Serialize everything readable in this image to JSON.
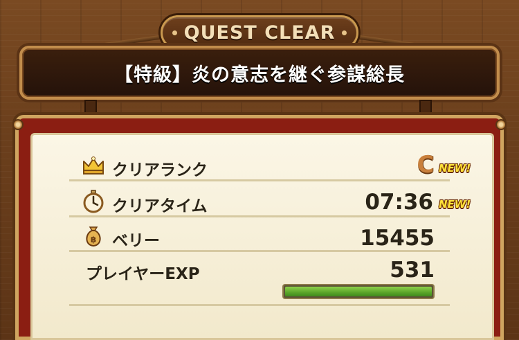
{
  "header": {
    "title": "QUEST CLEAR"
  },
  "quest": {
    "name": "【特級】炎の意志を継ぐ参謀総長"
  },
  "results": {
    "clear_rank": {
      "label": "クリアランク",
      "value": "C",
      "new": "NEW!"
    },
    "clear_time": {
      "label": "クリアタイム",
      "value": "07:36",
      "new": "NEW!"
    },
    "berry": {
      "label": "ベリー",
      "value": "15455"
    },
    "player_exp": {
      "label": "プレイヤーEXP",
      "value": "531",
      "bar_fraction": 1.0
    }
  },
  "icons": [
    "crown-icon",
    "stopwatch-icon",
    "money-bag-icon"
  ],
  "colors": {
    "panel_red": "#8b1e12",
    "exp_green": "#6cbf32",
    "new_yellow": "#ffe23a"
  }
}
